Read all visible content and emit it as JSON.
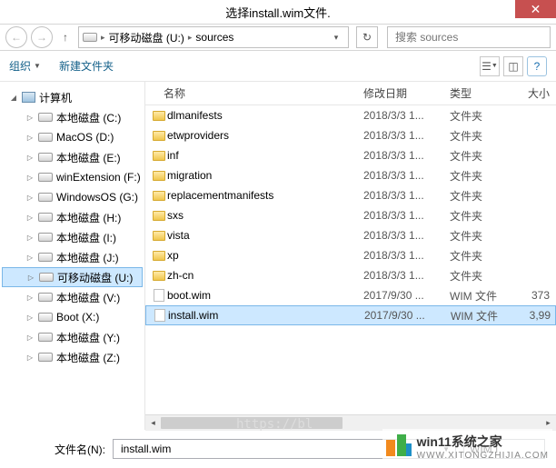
{
  "window": {
    "title": "选择install.wim文件."
  },
  "address": {
    "drive_label": "可移动磁盘 (U:)",
    "folder": "sources"
  },
  "search": {
    "placeholder": "搜索 sources"
  },
  "toolbar": {
    "organize": "组织",
    "new_folder": "新建文件夹"
  },
  "columns": {
    "name": "名称",
    "date": "修改日期",
    "type": "类型",
    "size": "大小"
  },
  "tree": {
    "root": "计算机",
    "items": [
      {
        "label": "本地磁盘 (C:)"
      },
      {
        "label": "MacOS (D:)"
      },
      {
        "label": "本地磁盘 (E:)"
      },
      {
        "label": "winExtension (F:)"
      },
      {
        "label": "WindowsOS (G:)"
      },
      {
        "label": "本地磁盘 (H:)"
      },
      {
        "label": "本地磁盘 (I:)"
      },
      {
        "label": "本地磁盘 (J:)"
      },
      {
        "label": "可移动磁盘 (U:)",
        "selected": true
      },
      {
        "label": "本地磁盘 (V:)"
      },
      {
        "label": "Boot (X:)"
      },
      {
        "label": "本地磁盘 (Y:)"
      },
      {
        "label": "本地磁盘 (Z:)"
      }
    ]
  },
  "files": [
    {
      "kind": "folder",
      "name": "dlmanifests",
      "date": "2018/3/3 1...",
      "type": "文件夹",
      "size": ""
    },
    {
      "kind": "folder",
      "name": "etwproviders",
      "date": "2018/3/3 1...",
      "type": "文件夹",
      "size": ""
    },
    {
      "kind": "folder",
      "name": "inf",
      "date": "2018/3/3 1...",
      "type": "文件夹",
      "size": ""
    },
    {
      "kind": "folder",
      "name": "migration",
      "date": "2018/3/3 1...",
      "type": "文件夹",
      "size": ""
    },
    {
      "kind": "folder",
      "name": "replacementmanifests",
      "date": "2018/3/3 1...",
      "type": "文件夹",
      "size": ""
    },
    {
      "kind": "folder",
      "name": "sxs",
      "date": "2018/3/3 1...",
      "type": "文件夹",
      "size": ""
    },
    {
      "kind": "folder",
      "name": "vista",
      "date": "2018/3/3 1...",
      "type": "文件夹",
      "size": ""
    },
    {
      "kind": "folder",
      "name": "xp",
      "date": "2018/3/3 1...",
      "type": "文件夹",
      "size": ""
    },
    {
      "kind": "folder",
      "name": "zh-cn",
      "date": "2018/3/3 1...",
      "type": "文件夹",
      "size": ""
    },
    {
      "kind": "file",
      "name": "boot.wim",
      "date": "2017/9/30 ...",
      "type": "WIM 文件",
      "size": "373"
    },
    {
      "kind": "file",
      "name": "install.wim",
      "date": "2017/9/30 ...",
      "type": "WIM 文件",
      "size": "3,99",
      "selected": true
    }
  ],
  "bottom": {
    "filename_label": "文件名(N):",
    "filename_value": "install.wim",
    "filter_label": "WIM I"
  },
  "watermark": {
    "line1": "win11系统之家",
    "line2": "WWW.XITONGZHIJIA.COM"
  },
  "ghost_url": "https://bl"
}
